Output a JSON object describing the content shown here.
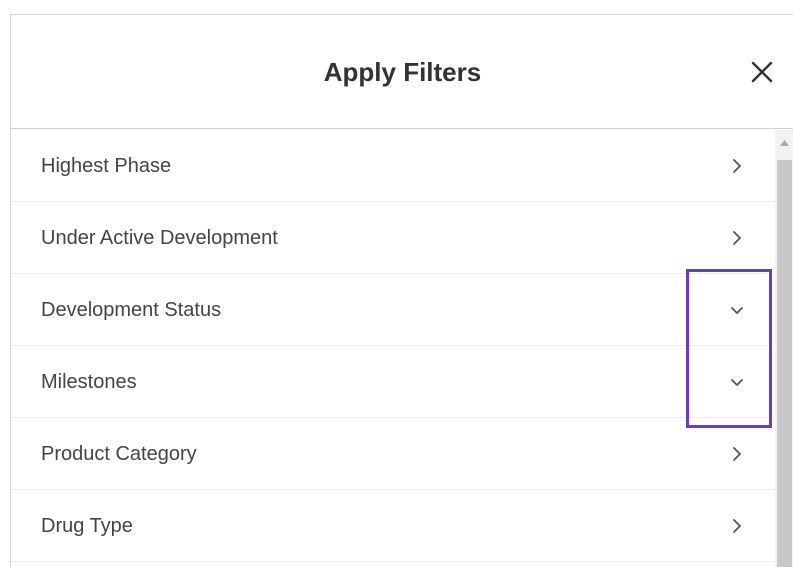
{
  "dialog": {
    "title": "Apply Filters",
    "close_icon": "close-icon"
  },
  "filters": [
    {
      "label": "Highest Phase",
      "icon": "chevron-right-icon",
      "expanded": false
    },
    {
      "label": "Under Active Development",
      "icon": "chevron-right-icon",
      "expanded": false
    },
    {
      "label": "Development Status",
      "icon": "chevron-down-icon",
      "expanded": true
    },
    {
      "label": "Milestones",
      "icon": "chevron-down-icon",
      "expanded": true
    },
    {
      "label": "Product Category",
      "icon": "chevron-right-icon",
      "expanded": false
    },
    {
      "label": "Drug Type",
      "icon": "chevron-right-icon",
      "expanded": false
    }
  ],
  "colors": {
    "highlight": "#6a3cc4",
    "text": "#444444",
    "title": "#333333"
  }
}
